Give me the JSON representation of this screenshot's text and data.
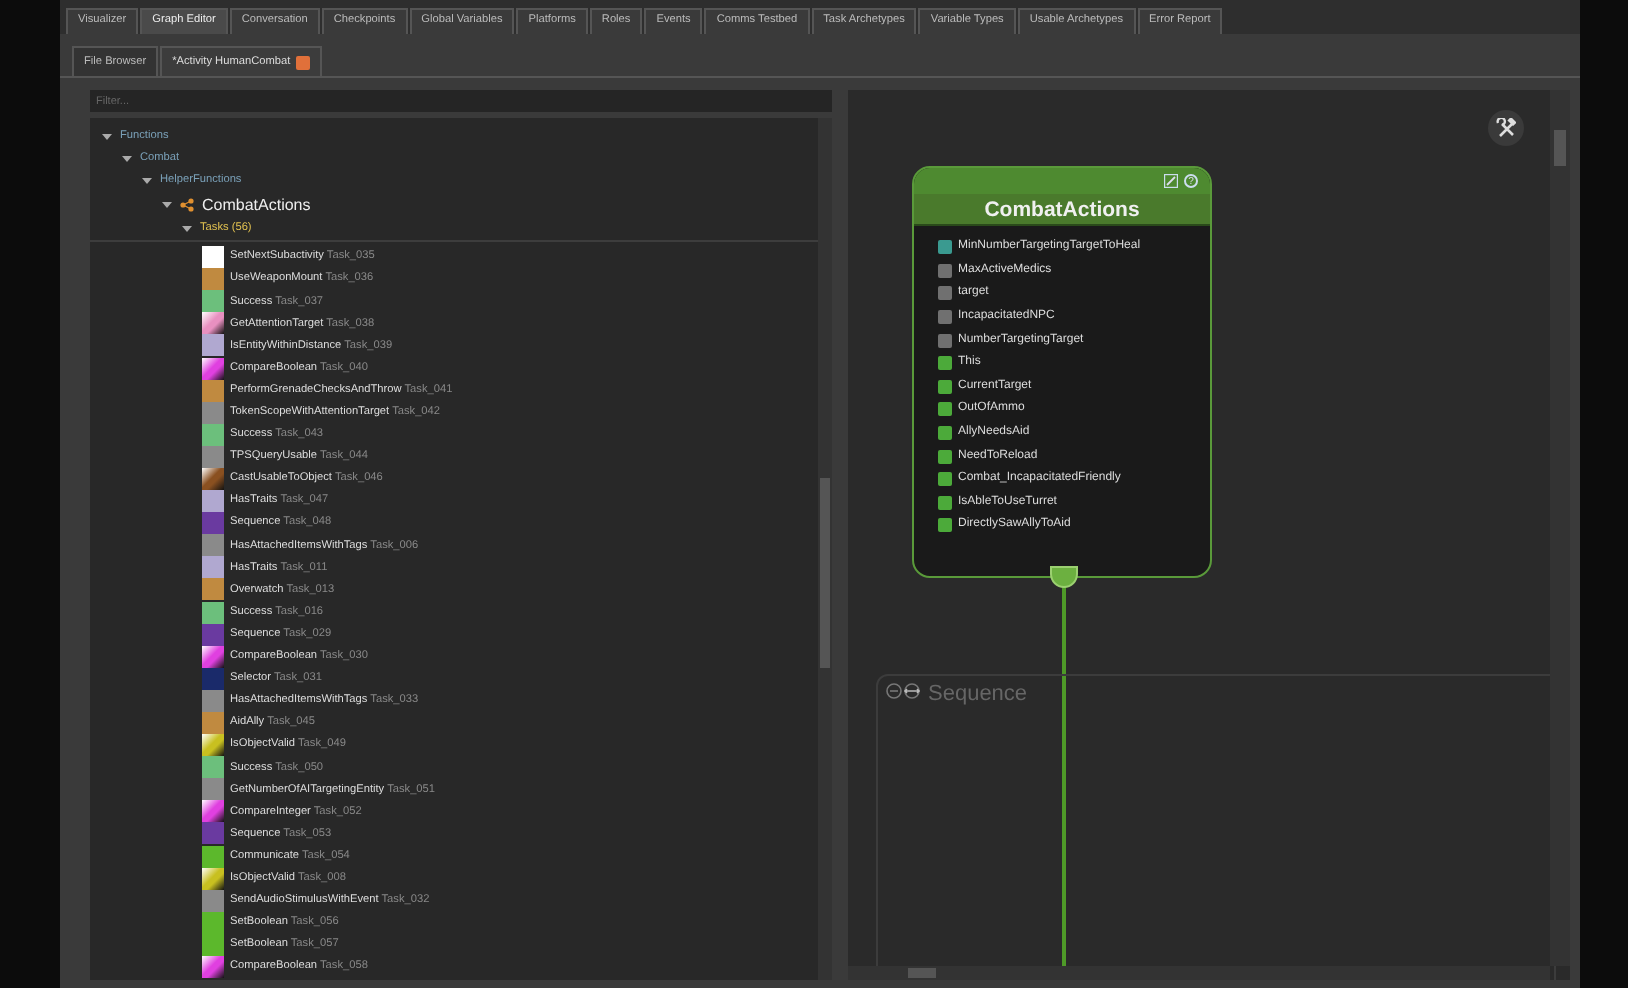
{
  "main_tabs": [
    {
      "label": "Visualizer",
      "selected": false
    },
    {
      "label": "Graph Editor",
      "selected": true
    },
    {
      "label": "Conversation",
      "selected": false
    },
    {
      "label": "Checkpoints",
      "selected": false
    },
    {
      "label": "Global Variables",
      "selected": false
    },
    {
      "label": "Platforms",
      "selected": false
    },
    {
      "label": "Roles",
      "selected": false
    },
    {
      "label": "Events",
      "selected": false
    },
    {
      "label": "Comms Testbed",
      "selected": false
    },
    {
      "label": "Task Archetypes",
      "selected": false
    },
    {
      "label": "Variable Types",
      "selected": false
    },
    {
      "label": "Usable Archetypes",
      "selected": false
    },
    {
      "label": "Error Report",
      "selected": false
    }
  ],
  "doc_tabs": [
    {
      "label": "File Browser",
      "selected": false,
      "closable": false
    },
    {
      "label": "*Activity HumanCombat",
      "selected": true,
      "closable": true
    }
  ],
  "filter": {
    "placeholder": "Filter..."
  },
  "tree": [
    {
      "label": "Functions",
      "kind": "folder",
      "expanded": true,
      "children": [
        {
          "label": "Combat",
          "kind": "folder",
          "expanded": true,
          "children": [
            {
              "label": "HelperFunctions",
              "kind": "folder",
              "expanded": true,
              "children": [
                {
                  "label": "CombatActions",
                  "kind": "graph",
                  "expanded": true,
                  "children": [
                    {
                      "label": "Tasks (56)",
                      "kind": "group",
                      "expanded": true
                    }
                  ]
                }
              ]
            }
          ]
        }
      ]
    }
  ],
  "tasks": [
    {
      "name": "SetNextSubactivity",
      "id": "Task_035",
      "color": "#ffffff",
      "kind": "solid"
    },
    {
      "name": "UseWeaponMount",
      "id": "Task_036",
      "color": "#c08a40",
      "kind": "solid"
    },
    {
      "name": "Success",
      "id": "Task_037",
      "color": "#6cbf7c",
      "kind": "solid"
    },
    {
      "name": "GetAttentionTarget",
      "id": "Task_038",
      "color": "#e890c0",
      "kind": "gradient"
    },
    {
      "name": "IsEntityWithinDistance",
      "id": "Task_039",
      "color": "#b0a8d0",
      "kind": "solid"
    },
    {
      "name": "CompareBoolean",
      "id": "Task_040",
      "color": "#e040e0",
      "kind": "gradient"
    },
    {
      "name": "PerformGrenadeChecksAndThrow",
      "id": "Task_041",
      "color": "#c08a40",
      "kind": "solid"
    },
    {
      "name": "TokenScopeWithAttentionTarget",
      "id": "Task_042",
      "color": "#8a8a8a",
      "kind": "solid"
    },
    {
      "name": "Success",
      "id": "Task_043",
      "color": "#6cbf7c",
      "kind": "solid"
    },
    {
      "name": "TPSQueryUsable",
      "id": "Task_044",
      "color": "#8a8a8a",
      "kind": "solid"
    },
    {
      "name": "CastUsableToObject",
      "id": "Task_046",
      "color": "#8a5020",
      "kind": "gradient"
    },
    {
      "name": "HasTraits",
      "id": "Task_047",
      "color": "#b0a8d0",
      "kind": "solid"
    },
    {
      "name": "Sequence",
      "id": "Task_048",
      "color": "#6a3aa0",
      "kind": "solid"
    },
    {
      "name": "HasAttachedItemsWithTags",
      "id": "Task_006",
      "color": "#8a8a8a",
      "kind": "solid"
    },
    {
      "name": "HasTraits",
      "id": "Task_011",
      "color": "#b0a8d0",
      "kind": "solid"
    },
    {
      "name": "Overwatch",
      "id": "Task_013",
      "color": "#c08a40",
      "kind": "solid"
    },
    {
      "name": "Success",
      "id": "Task_016",
      "color": "#6cbf7c",
      "kind": "solid"
    },
    {
      "name": "Sequence",
      "id": "Task_029",
      "color": "#6a3aa0",
      "kind": "solid"
    },
    {
      "name": "CompareBoolean",
      "id": "Task_030",
      "color": "#e040e0",
      "kind": "gradient"
    },
    {
      "name": "Selector",
      "id": "Task_031",
      "color": "#1a2a6a",
      "kind": "solid"
    },
    {
      "name": "HasAttachedItemsWithTags",
      "id": "Task_033",
      "color": "#8a8a8a",
      "kind": "solid"
    },
    {
      "name": "AidAlly",
      "id": "Task_045",
      "color": "#c08a40",
      "kind": "solid"
    },
    {
      "name": "IsObjectValid",
      "id": "Task_049",
      "color": "#c8c020",
      "kind": "gradient"
    },
    {
      "name": "Success",
      "id": "Task_050",
      "color": "#6cbf7c",
      "kind": "solid"
    },
    {
      "name": "GetNumberOfAITargetingEntity",
      "id": "Task_051",
      "color": "#8a8a8a",
      "kind": "solid"
    },
    {
      "name": "CompareInteger",
      "id": "Task_052",
      "color": "#e040e0",
      "kind": "gradient"
    },
    {
      "name": "Sequence",
      "id": "Task_053",
      "color": "#6a3aa0",
      "kind": "solid"
    },
    {
      "name": "Communicate",
      "id": "Task_054",
      "color": "#5cb82c",
      "kind": "solid"
    },
    {
      "name": "IsObjectValid",
      "id": "Task_008",
      "color": "#c8c020",
      "kind": "gradient"
    },
    {
      "name": "SendAudioStimulusWithEvent",
      "id": "Task_032",
      "color": "#8a8a8a",
      "kind": "solid"
    },
    {
      "name": "SetBoolean",
      "id": "Task_056",
      "color": "#5cb82c",
      "kind": "solid"
    },
    {
      "name": "SetBoolean",
      "id": "Task_057",
      "color": "#5cb82c",
      "kind": "solid"
    },
    {
      "name": "CompareBoolean",
      "id": "Task_058",
      "color": "#e040e0",
      "kind": "gradient"
    }
  ],
  "node": {
    "title": "CombatActions",
    "help": "?",
    "variables": [
      {
        "name": "MinNumberTargetingTargetToHeal",
        "kind": "number"
      },
      {
        "name": "MaxActiveMedics",
        "kind": "local"
      },
      {
        "name": "target",
        "kind": "local"
      },
      {
        "name": "IncapacitatedNPC",
        "kind": "local"
      },
      {
        "name": "NumberTargetingTarget",
        "kind": "local"
      },
      {
        "name": "This",
        "kind": "global"
      },
      {
        "name": "CurrentTarget",
        "kind": "global"
      },
      {
        "name": "OutOfAmmo",
        "kind": "global"
      },
      {
        "name": "AllyNeedsAid",
        "kind": "global"
      },
      {
        "name": "NeedToReload",
        "kind": "global"
      },
      {
        "name": "Combat_IncapacitatedFriendly",
        "kind": "global"
      },
      {
        "name": "IsAbleToUseTurret",
        "kind": "global"
      },
      {
        "name": "DirectlySawAllyToAid",
        "kind": "global"
      }
    ]
  },
  "sequence": {
    "title": "Sequence"
  }
}
